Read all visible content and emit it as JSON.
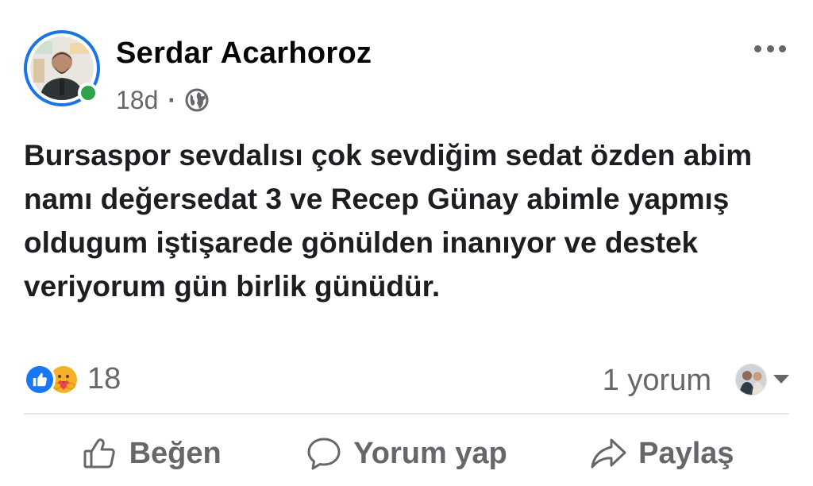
{
  "post": {
    "author_name": "Serdar Acarhoroz",
    "timestamp": "18d",
    "separator": "·",
    "audience_icon": "globe-icon",
    "body_text": "Bursaspor sevdalısı çok sevdiğim sedat özden abim namı değersedat 3 ve Recep Günay abimle yapmış oldugum iştişarede gönülden inanıyor ve destek veriyorum gün birlik günüdür.",
    "online": true
  },
  "stats": {
    "reaction_icons": [
      "like-reaction-icon",
      "care-reaction-icon"
    ],
    "reaction_count": "18",
    "comment_count": "1 yorum"
  },
  "actions": {
    "like_label": "Beğen",
    "comment_label": "Yorum yap",
    "share_label": "Paylaş"
  },
  "colors": {
    "brand_blue": "#1877f2",
    "secondary_text": "#65676b",
    "online_green": "#31a24c",
    "divider": "#e4e6eb"
  }
}
